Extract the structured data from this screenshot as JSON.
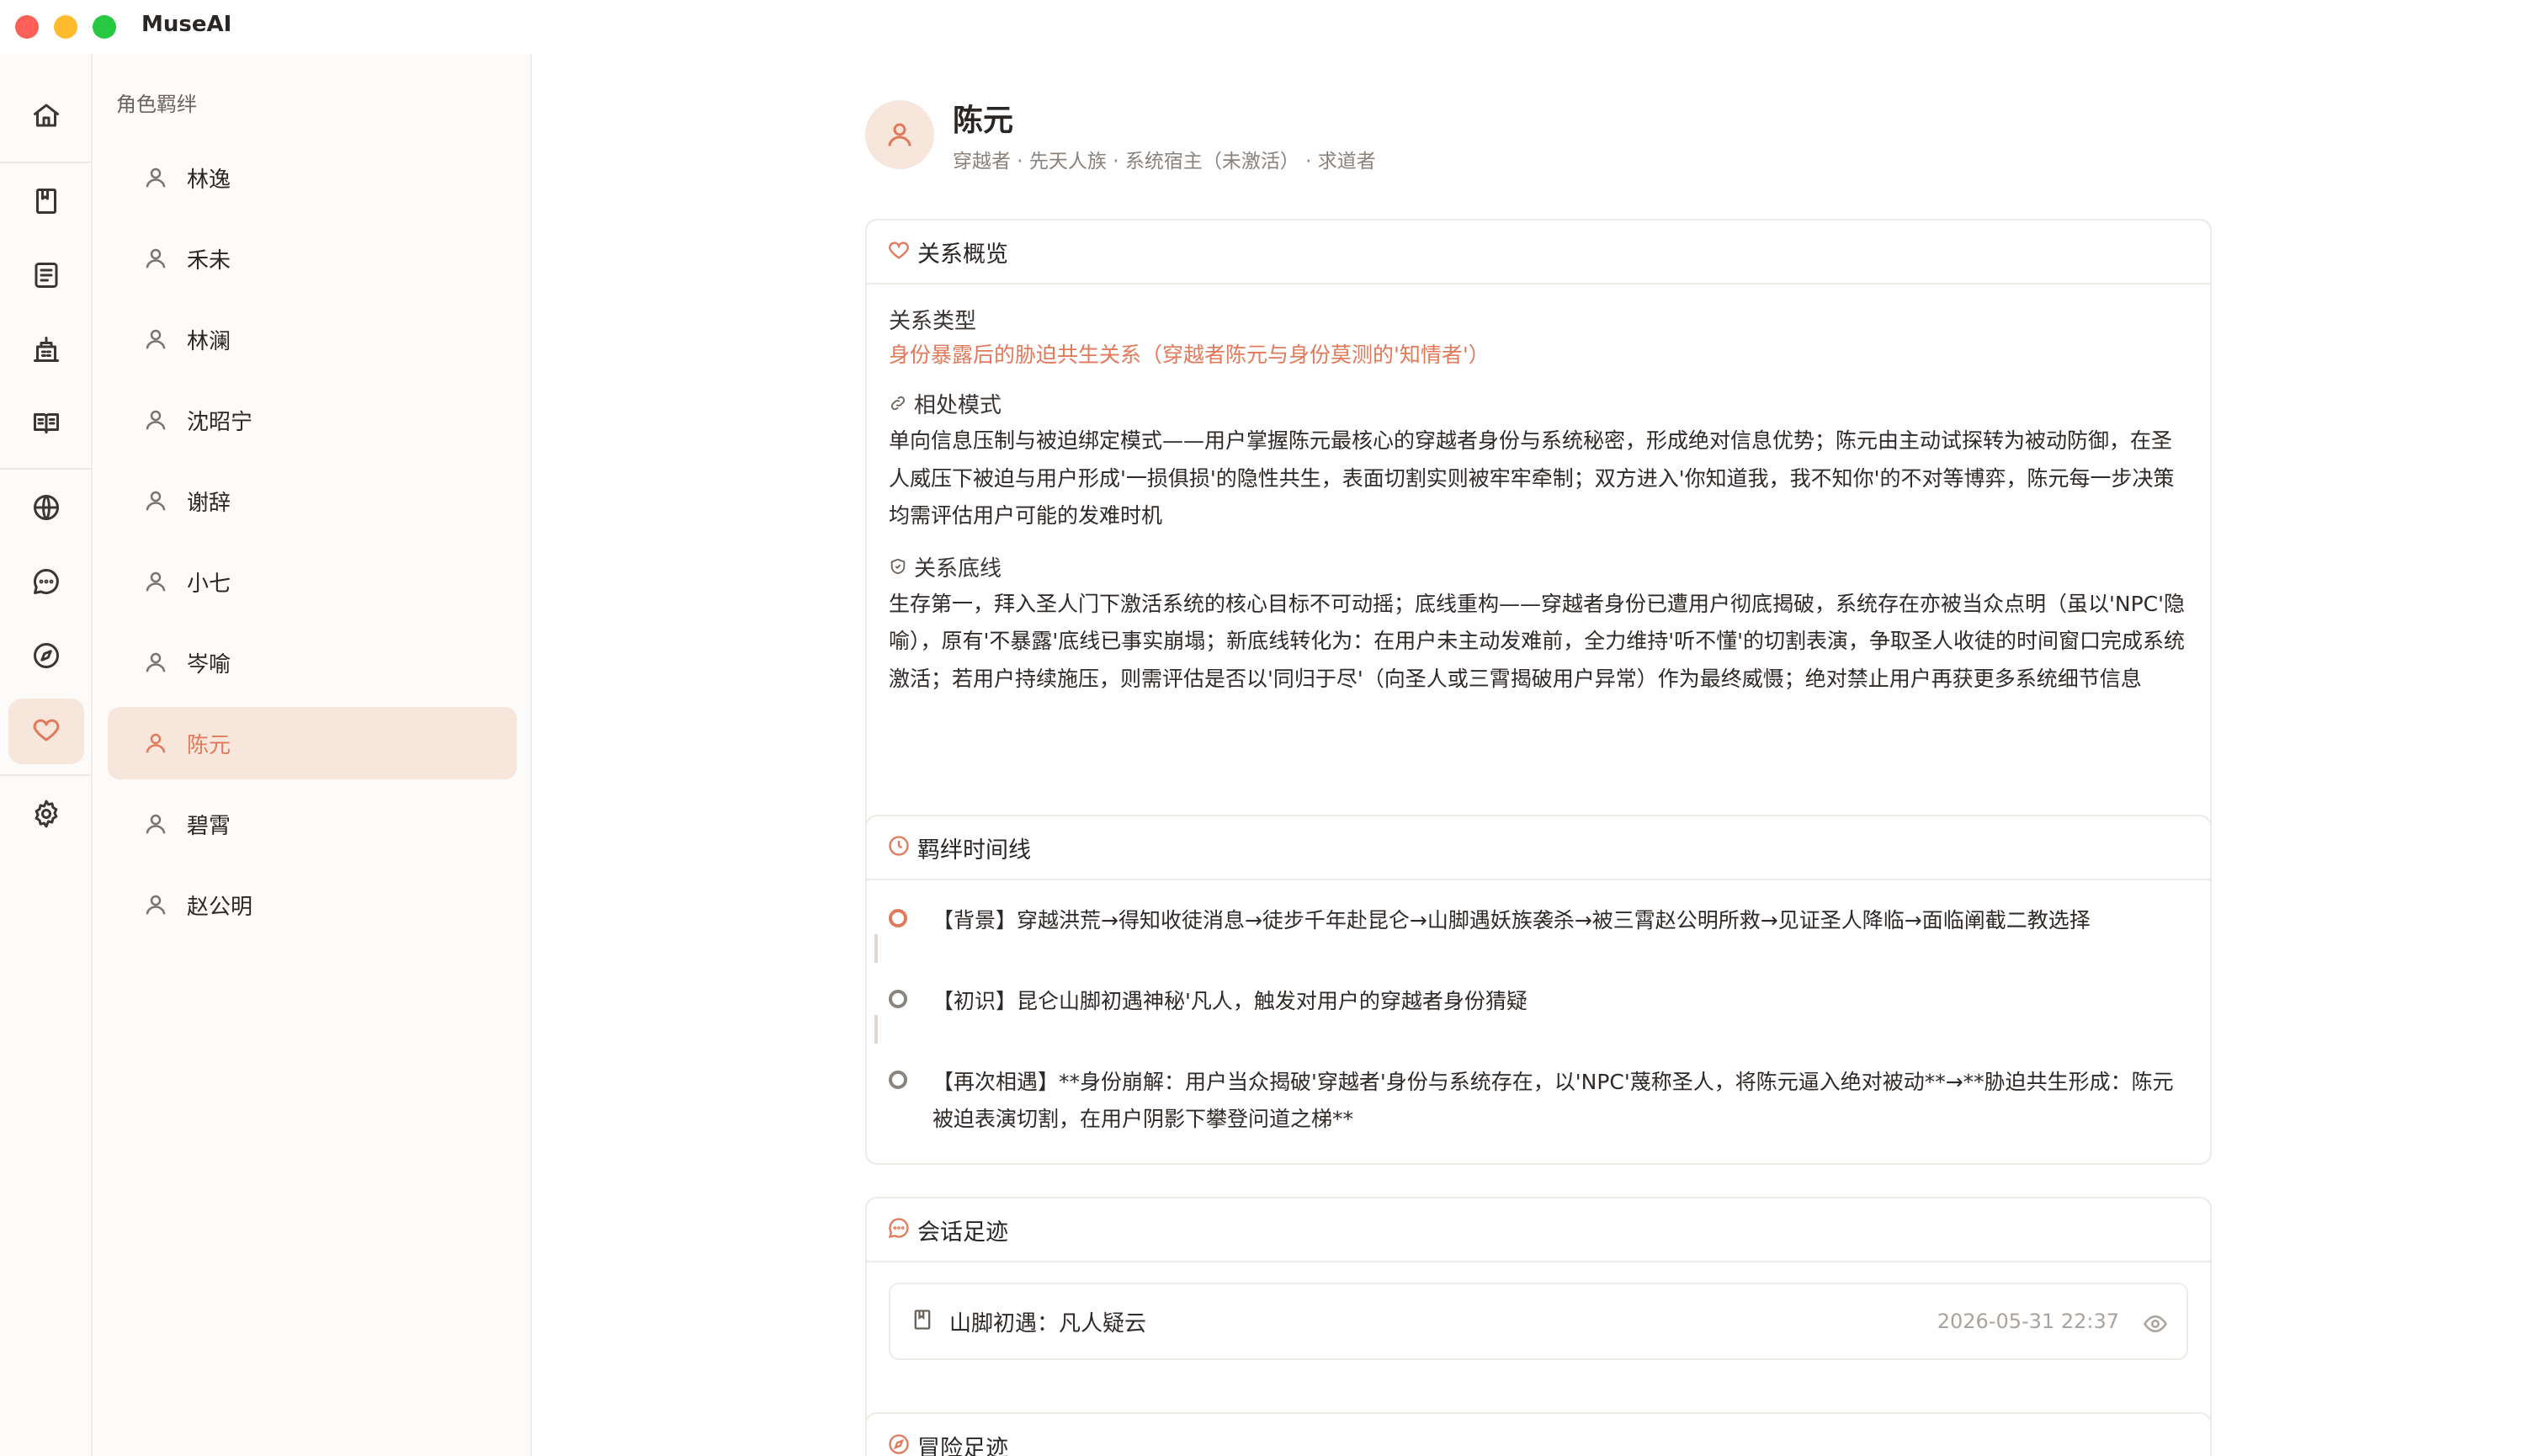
{
  "app": {
    "title": "MuseAI"
  },
  "rail": {
    "items": [
      {
        "icon": "home-icon"
      },
      {
        "icon": "book-icon"
      },
      {
        "icon": "list-icon"
      },
      {
        "icon": "building-icon"
      },
      {
        "icon": "open-book-icon"
      },
      {
        "icon": "globe-icon"
      },
      {
        "icon": "chat-icon"
      },
      {
        "icon": "compass-icon"
      },
      {
        "icon": "heart-icon",
        "active": true
      },
      {
        "icon": "gear-icon"
      }
    ]
  },
  "characters": {
    "title": "角色羁绊",
    "items": [
      {
        "name": "林逸"
      },
      {
        "name": "禾未"
      },
      {
        "name": "林澜"
      },
      {
        "name": "沈昭宁"
      },
      {
        "name": "谢辞"
      },
      {
        "name": "小七"
      },
      {
        "name": "岑喻"
      },
      {
        "name": "陈元",
        "active": true
      },
      {
        "name": "碧霄"
      },
      {
        "name": "赵公明"
      }
    ]
  },
  "profile": {
    "name": "陈元",
    "meta": "穿越者 · 先天人族 · 系统宿主（未激活） · 求道者"
  },
  "overview": {
    "title": "关系概览",
    "type_label": "关系类型",
    "type_value": "身份暴露后的胁迫共生关系（穿越者陈元与身份莫测的'知情者'）",
    "mode_label": "相处模式",
    "mode_text": "单向信息压制与被迫绑定模式——用户掌握陈元最核心的穿越者身份与系统秘密，形成绝对信息优势；陈元由主动试探转为被动防御，在圣人威压下被迫与用户形成'一损俱损'的隐性共生，表面切割实则被牢牢牵制；双方进入'你知道我，我不知你'的不对等博弈，陈元每一步决策均需评估用户可能的发难时机",
    "bottom_label": "关系底线",
    "bottom_text": "生存第一，拜入圣人门下激活系统的核心目标不可动摇；底线重构——穿越者身份已遭用户彻底揭破，系统存在亦被当众点明（虽以'NPC'隐喻），原有'不暴露'底线已事实崩塌；新底线转化为：在用户未主动发难前，全力维持'听不懂'的切割表演，争取圣人收徒的时间窗口完成系统激活；若用户持续施压，则需评估是否以'同归于尽'（向圣人或三霄揭破用户异常）作为最终威慑；绝对禁止用户再获更多系统细节信息"
  },
  "timeline": {
    "title": "羁绊时间线",
    "items": [
      {
        "text": "【背景】穿越洪荒→得知收徒消息→徒步千年赴昆仑→山脚遇妖族袭杀→被三霄赵公明所救→见证圣人降临→面临阐截二教选择"
      },
      {
        "text": "【初识】昆仑山脚初遇神秘'凡人，触发对用户的穿越者身份猜疑"
      },
      {
        "text": "【再次相遇】**身份崩解：用户当众揭破'穿越者'身份与系统存在，以'NPC'蔑称圣人，将陈元逼入绝对被动**→**胁迫共生形成：陈元被迫表演切割，在用户阴影下攀登问道之梯**"
      }
    ]
  },
  "sessions": {
    "title": "会话足迹",
    "items": [
      {
        "title": "山脚初遇：凡人疑云",
        "date": "2026-05-31 22:37"
      }
    ]
  },
  "adventures": {
    "title": "冒险足迹"
  },
  "colors": {
    "accent": "#e2795a",
    "active_bg": "#f6e6dc",
    "text": "#2b2724",
    "muted": "#8a827c"
  }
}
